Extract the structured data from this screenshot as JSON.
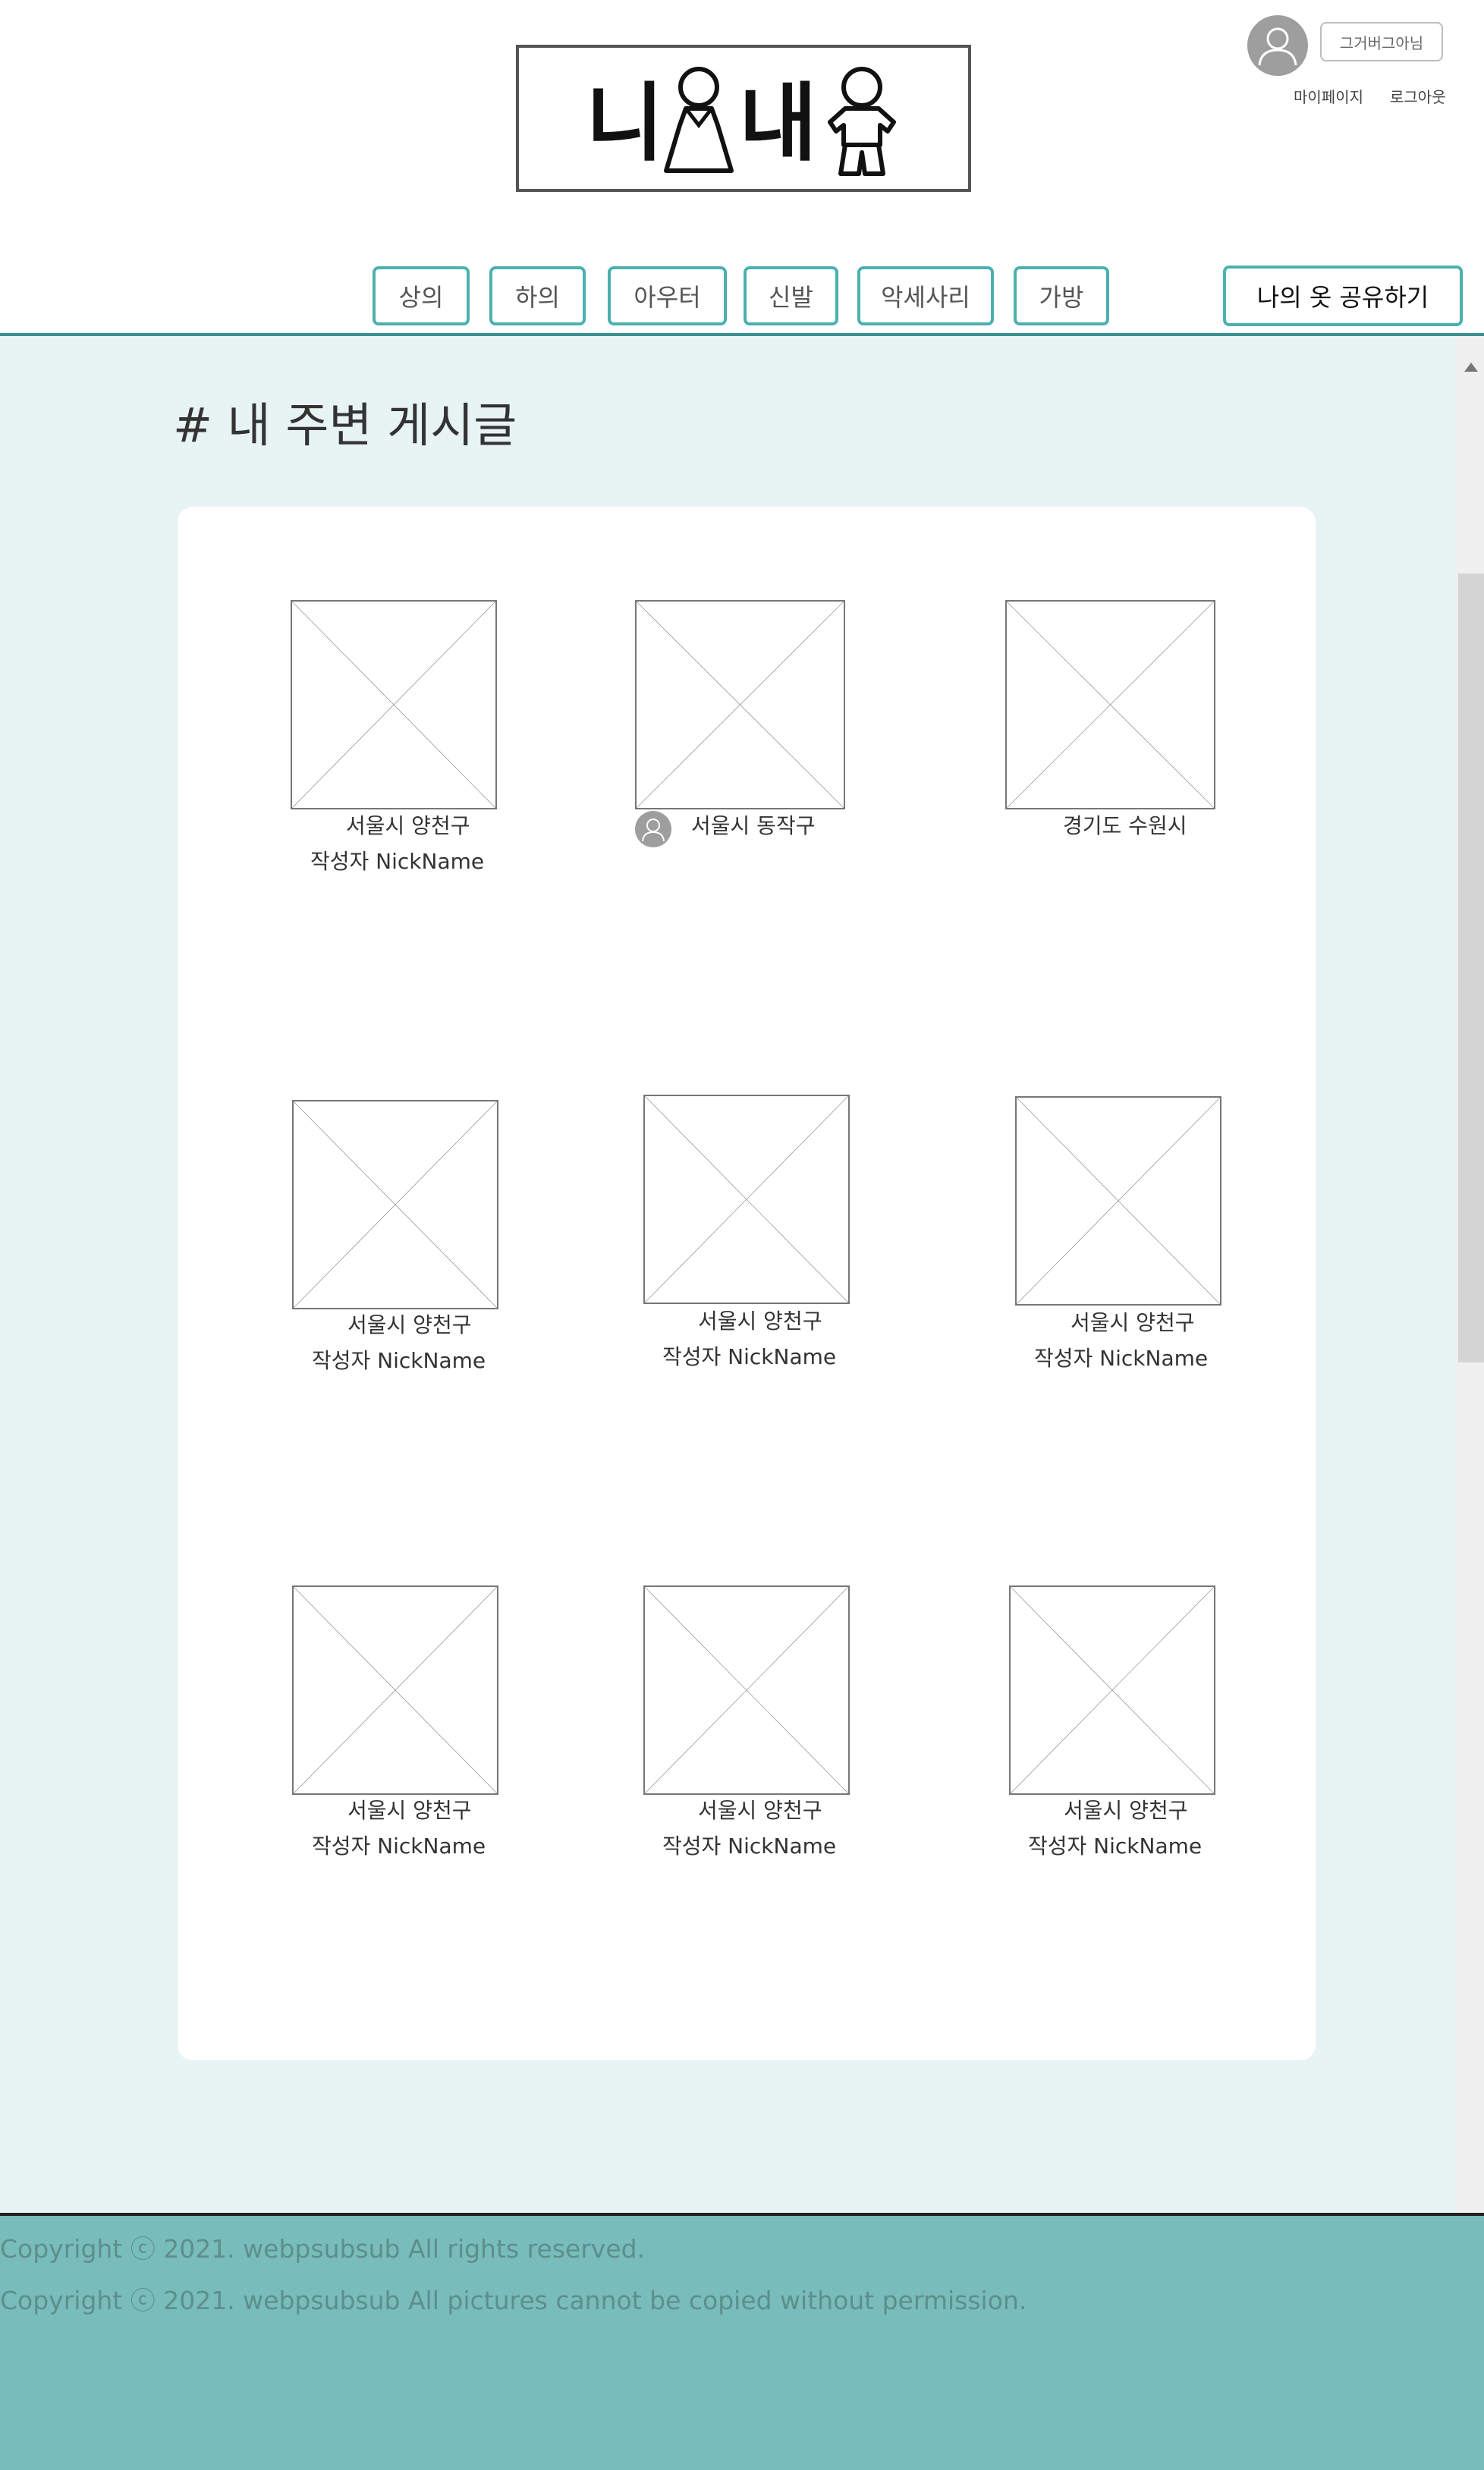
{
  "header": {
    "logo_text": "니내",
    "user_badge": "그거버그아님",
    "mypage_label": "마이페이지",
    "logout_label": "로그아웃",
    "categories": [
      "상의",
      "하의",
      "아우터",
      "신발",
      "악세사리",
      "가방"
    ],
    "share_button": "나의 옷 공유하기"
  },
  "main": {
    "title": "# 내 주변 게시글",
    "posts": [
      {
        "location": "서울시 양천구",
        "author": "작성자 NickName"
      },
      {
        "location": "서울시 동작구",
        "author": ""
      },
      {
        "location": "경기도 수원시",
        "author": ""
      },
      {
        "location": "서울시 양천구",
        "author": "작성자 NickName"
      },
      {
        "location": "서울시 양천구",
        "author": "작성자 NickName"
      },
      {
        "location": "서울시 양천구",
        "author": "작성자 NickName"
      },
      {
        "location": "서울시 양천구",
        "author": "작성자 NickName"
      },
      {
        "location": "서울시 양천구",
        "author": "작성자 NickName"
      },
      {
        "location": "서울시 양천구",
        "author": "작성자 NickName"
      }
    ]
  },
  "footer": {
    "line1": "Copyright ⓒ 2021. webpsubsub  All rights reserved.",
    "line2": "Copyright ⓒ 2021. webpsubsub  All pictures cannot be copied without permission."
  },
  "colors": {
    "accent": "#4bb0b0",
    "main_bg": "#e8f3f3",
    "footer_bg": "#78bdbb"
  }
}
